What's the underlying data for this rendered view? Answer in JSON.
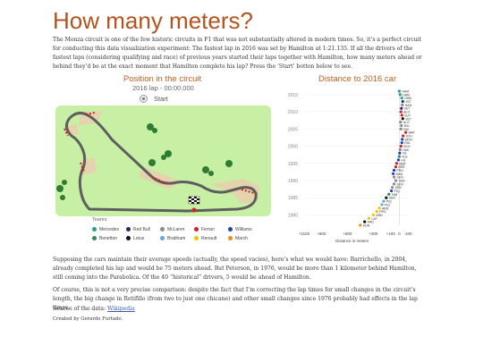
{
  "title": "How many meters?",
  "intro": "The Monza circuit is one of the few historic circuits in F1 that was not substantially altered in modern times. So, it’s a perfect circuit for conducting this data visualization experiment: The fastest lap in 2016 was set by Hamilton at 1:21.135. If all the drivers of the fastest laps (considering qualifying and race) of previous years started their laps together with Hamilton, how many meters ahead or behind they’d be at the exact moment that Hamilton complete his lap? Press the ‘Start’ botton below to see.",
  "circuit": {
    "heading": "Position in the circuit",
    "lap_time": "2016 lap - 00:00.000",
    "start_label": "Start"
  },
  "teams": {
    "title": "Teams:",
    "items": [
      {
        "name": "Mercedes",
        "color": "#2a9d8f"
      },
      {
        "name": "Red Bull",
        "color": "#1e2a78"
      },
      {
        "name": "McLaren",
        "color": "#8a8a8a"
      },
      {
        "name": "Ferrari",
        "color": "#d62020"
      },
      {
        "name": "Williams",
        "color": "#1a3fbf"
      },
      {
        "name": "Benetton",
        "color": "#2e8b57"
      },
      {
        "name": "Lotus",
        "color": "#111111"
      },
      {
        "name": "Brabham",
        "color": "#5aa8e0"
      },
      {
        "name": "Renault",
        "color": "#f2c200"
      },
      {
        "name": "March",
        "color": "#f08c1a"
      }
    ]
  },
  "chart": {
    "heading": "Distance to 2016 car",
    "xlabel": "Distance in meters"
  },
  "chart_data": {
    "type": "scatter",
    "title": "Distance to 2016 car",
    "xlabel": "Distance in meters",
    "ylabel": "",
    "xlim": [
      -1100,
      110
    ],
    "ylim": [
      1977,
      2016
    ],
    "x_ticks": [
      "+1100",
      "+900",
      "+600",
      "+300",
      "+100",
      "0",
      "-100"
    ],
    "x_tick_values": [
      -1100,
      -900,
      -600,
      -300,
      -100,
      0,
      100
    ],
    "y_ticks": [
      1980,
      1985,
      1990,
      1995,
      2000,
      2005,
      2010,
      2015
    ],
    "series": [
      {
        "year": 2016,
        "driver": "HAM",
        "team": "Mercedes",
        "distance": 0
      },
      {
        "year": 2015,
        "driver": "HAM",
        "team": "Mercedes",
        "distance": 10
      },
      {
        "year": 2014,
        "driver": "HAM",
        "team": "Mercedes",
        "distance": 30
      },
      {
        "year": 2013,
        "driver": "VET",
        "team": "Red Bull",
        "distance": 40
      },
      {
        "year": 2012,
        "driver": "HAM",
        "team": "McLaren",
        "distance": 35
      },
      {
        "year": 2011,
        "driver": "VET",
        "team": "Red Bull",
        "distance": 25
      },
      {
        "year": 2010,
        "driver": "ALO",
        "team": "Ferrari",
        "distance": 20
      },
      {
        "year": 2009,
        "driver": "SUT",
        "team": "Ferrari",
        "distance": 30
      },
      {
        "year": 2008,
        "driver": "VET",
        "team": "Lotus",
        "distance": 40
      },
      {
        "year": 2007,
        "driver": "ALO",
        "team": "McLaren",
        "distance": 15
      },
      {
        "year": 2006,
        "driver": "RAI",
        "team": "McLaren",
        "distance": 25
      },
      {
        "year": 2005,
        "driver": "RAI",
        "team": "McLaren",
        "distance": 20
      },
      {
        "year": 2004,
        "driver": "BAR",
        "team": "Ferrari",
        "distance": 75
      },
      {
        "year": 2003,
        "driver": "SCH",
        "team": "Ferrari",
        "distance": 45
      },
      {
        "year": 2002,
        "driver": "MON",
        "team": "Williams",
        "distance": 35
      },
      {
        "year": 2001,
        "driver": "RAL",
        "team": "Williams",
        "distance": 30
      },
      {
        "year": 2000,
        "driver": "SCH",
        "team": "Ferrari",
        "distance": 20
      },
      {
        "year": 1999,
        "driver": "HAK",
        "team": "McLaren",
        "distance": 10
      },
      {
        "year": 1998,
        "driver": "VIL",
        "team": "Williams",
        "distance": 5
      },
      {
        "year": 1997,
        "driver": "ALE",
        "team": "Benetton",
        "distance": 0
      },
      {
        "year": 1996,
        "driver": "HIL",
        "team": "Williams",
        "distance": -10
      },
      {
        "year": 1995,
        "driver": "BER",
        "team": "Ferrari",
        "distance": -30
      },
      {
        "year": 1994,
        "driver": "BER",
        "team": "Ferrari",
        "distance": -40
      },
      {
        "year": 1993,
        "driver": "PRO",
        "team": "Williams",
        "distance": -60
      },
      {
        "year": 1992,
        "driver": "MAN",
        "team": "Williams",
        "distance": -70
      },
      {
        "year": 1991,
        "driver": "SEN",
        "team": "McLaren",
        "distance": -60
      },
      {
        "year": 1990,
        "driver": "SEN",
        "team": "McLaren",
        "distance": -40
      },
      {
        "year": 1989,
        "driver": "SEN",
        "team": "McLaren",
        "distance": -60
      },
      {
        "year": 1988,
        "driver": "SEN",
        "team": "McLaren",
        "distance": -80
      },
      {
        "year": 1987,
        "driver": "PIQ",
        "team": "Williams",
        "distance": -90
      },
      {
        "year": 1986,
        "driver": "FAB",
        "team": "Benetton",
        "distance": -120
      },
      {
        "year": 1985,
        "driver": "SEN",
        "team": "Lotus",
        "distance": -150
      },
      {
        "year": 1984,
        "driver": "PIQ",
        "team": "Brabham",
        "distance": -180
      },
      {
        "year": 1983,
        "driver": "PIQ",
        "team": "Brabham",
        "distance": -200
      },
      {
        "year": 1982,
        "driver": "ARN",
        "team": "Renault",
        "distance": -230
      },
      {
        "year": 1981,
        "driver": "PRO",
        "team": "Renault",
        "distance": -260
      },
      {
        "year": 1980,
        "driver": "ARN",
        "team": "Renault",
        "distance": -300
      },
      {
        "year": 1979,
        "driver": "LAF",
        "team": "Renault",
        "distance": -350
      },
      {
        "year": 1978,
        "driver": "AND",
        "team": "Lotus",
        "distance": -400
      },
      {
        "year": 1977,
        "driver": "HUN",
        "team": "March",
        "distance": -450
      }
    ]
  },
  "body": {
    "p1": "Supposing the cars maintain their average speeds (actually, the speed vacies), here’s what we would have: Barrichello, in 2004, already completed his lap and would be 75 meters ahead. But Peterson, in 1976, would be more than 1 kilometer behind Hamilton, still coming into the Parabolica. Of the 40 “historical” drivers, 5 would be ahead of Hamilton.",
    "p2": "Of course, this is not a very precise comparison: despite the fact that I’m correcting the lap times for small changes in the circuit’s length, the big change in Retifillo (from two to just one chicane) and other small changes since 1976 probably had effects in the lap times.",
    "source_prefix": "Source of the data: ",
    "source_link": "Wikipedia",
    "credit": "Created by Gerardo Furtado."
  },
  "colors": {
    "accent": "#b3541e",
    "grass": "#c7f0a4",
    "sand": "#e5d3ad",
    "track": "#5e5e5e"
  }
}
